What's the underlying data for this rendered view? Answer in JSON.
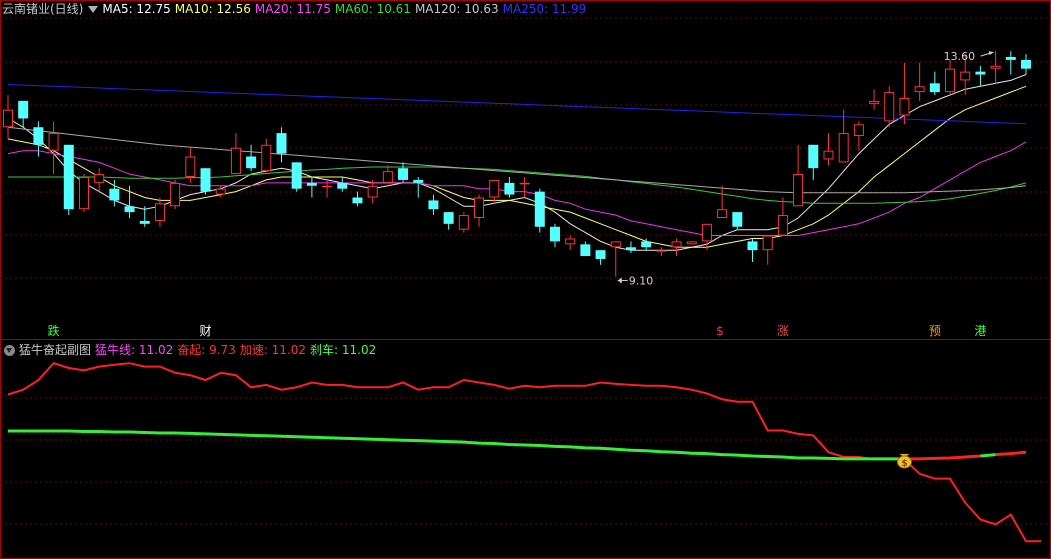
{
  "main_header": {
    "title": "云南锗业(日线)",
    "ma": [
      {
        "label": "MA5: 12.75",
        "color": "#ffffff"
      },
      {
        "label": "MA10: 12.56",
        "color": "#ffff66"
      },
      {
        "label": "MA20: 11.75",
        "color": "#ff44ff"
      },
      {
        "label": "MA60: 10.61",
        "color": "#33dd33"
      },
      {
        "label": "MA120: 10.63",
        "color": "#c8c8c8"
      },
      {
        "label": "MA250: 11.99",
        "color": "#3333ff"
      }
    ]
  },
  "sub_header": {
    "title": "猛牛奋起副图",
    "values": [
      {
        "label": "猛牛线: 11.02",
        "color": "#ff44ff"
      },
      {
        "label": "奋起: 9.73",
        "color": "#ff3333"
      },
      {
        "label": "加速: 11.02",
        "color": "#ff3333"
      },
      {
        "label": "刹车: 11.02",
        "color": "#44ff44"
      }
    ]
  },
  "annotations": {
    "high_label": "13.60",
    "low_label": "9.10"
  },
  "markers": [
    {
      "text": "跌",
      "color": "#44ff44",
      "date_index": 3
    },
    {
      "text": "财",
      "color": "#ffffff",
      "date_index": 13
    },
    {
      "text": "$",
      "color": "#ff3333",
      "date_index": 47
    },
    {
      "text": "涨",
      "color": "#ff4444",
      "date_index": 51
    },
    {
      "text": "预",
      "color": "#ff9900",
      "date_index": 61
    },
    {
      "text": "港",
      "color": "#44ff44",
      "date_index": 64
    }
  ],
  "money_bag": {
    "icon": "money-bag-icon",
    "date_index": 59
  },
  "chart_data": [
    {
      "type": "candlestick",
      "title": "云南锗业(日线)",
      "colors": {
        "up": "#ff3333",
        "down": "#54ffff"
      },
      "ylim": [
        8.7,
        14.2
      ],
      "ohlc": [
        [
          12.3,
          12.85,
          12.1,
          12.6
        ],
        [
          12.75,
          12.75,
          12.3,
          12.45
        ],
        [
          12.3,
          12.4,
          11.8,
          12.0
        ],
        [
          11.9,
          12.4,
          11.5,
          12.2
        ],
        [
          12.0,
          12.0,
          10.8,
          10.9
        ],
        [
          10.9,
          11.5,
          10.85,
          11.45
        ],
        [
          11.35,
          11.6,
          11.2,
          11.5
        ],
        [
          11.25,
          11.4,
          10.95,
          11.05
        ],
        [
          10.95,
          11.3,
          10.75,
          10.85
        ],
        [
          10.7,
          10.95,
          10.6,
          10.65
        ],
        [
          10.7,
          11.1,
          10.6,
          11.0
        ],
        [
          10.95,
          11.4,
          10.9,
          11.35
        ],
        [
          11.45,
          11.95,
          11.35,
          11.8
        ],
        [
          11.6,
          11.6,
          11.15,
          11.2
        ],
        [
          11.15,
          11.3,
          11.1,
          11.25
        ],
        [
          11.5,
          12.2,
          11.5,
          11.95
        ],
        [
          11.8,
          12.0,
          11.55,
          11.6
        ],
        [
          11.55,
          12.1,
          11.55,
          12.0
        ],
        [
          12.2,
          12.3,
          11.7,
          11.85
        ],
        [
          11.7,
          11.7,
          11.2,
          11.25
        ],
        [
          11.35,
          11.45,
          11.1,
          11.3
        ],
        [
          11.3,
          11.4,
          11.1,
          11.3
        ],
        [
          11.35,
          11.45,
          11.2,
          11.25
        ],
        [
          11.1,
          11.2,
          10.95,
          11.0
        ],
        [
          11.1,
          11.4,
          11.0,
          11.3
        ],
        [
          11.35,
          11.65,
          11.35,
          11.55
        ],
        [
          11.6,
          11.7,
          11.35,
          11.4
        ],
        [
          11.4,
          11.45,
          11.1,
          11.35
        ],
        [
          11.05,
          11.15,
          10.8,
          10.9
        ],
        [
          10.85,
          10.85,
          10.55,
          10.65
        ],
        [
          10.55,
          10.85,
          10.5,
          10.8
        ],
        [
          10.75,
          11.15,
          10.6,
          11.1
        ],
        [
          11.1,
          11.4,
          11.0,
          11.4
        ],
        [
          11.35,
          11.45,
          11.1,
          11.15
        ],
        [
          11.35,
          11.45,
          11.1,
          11.35
        ],
        [
          11.2,
          11.25,
          10.5,
          10.6
        ],
        [
          10.6,
          10.65,
          10.25,
          10.35
        ],
        [
          10.3,
          10.45,
          10.2,
          10.4
        ],
        [
          10.3,
          10.35,
          10.1,
          10.1
        ],
        [
          10.2,
          10.2,
          9.95,
          10.05
        ],
        [
          10.25,
          10.35,
          9.75,
          10.35
        ],
        [
          10.25,
          10.35,
          10.15,
          10.2
        ],
        [
          10.35,
          10.4,
          10.2,
          10.25
        ],
        [
          10.2,
          10.25,
          10.1,
          10.2
        ],
        [
          10.25,
          10.4,
          10.1,
          10.35
        ],
        [
          10.3,
          10.35,
          10.3,
          10.35
        ],
        [
          10.35,
          10.65,
          10.2,
          10.65
        ],
        [
          10.75,
          11.3,
          10.75,
          10.9
        ],
        [
          10.85,
          10.85,
          10.55,
          10.6
        ],
        [
          10.35,
          10.4,
          10.0,
          10.2
        ],
        [
          10.2,
          10.3,
          9.95,
          10.45
        ],
        [
          10.45,
          11.1,
          10.45,
          10.8
        ],
        [
          10.95,
          12.0,
          10.95,
          11.5
        ],
        [
          12.0,
          12.0,
          11.4,
          11.6
        ],
        [
          11.75,
          12.2,
          11.65,
          11.9
        ],
        [
          11.7,
          12.6,
          11.7,
          12.2
        ],
        [
          12.15,
          12.4,
          11.9,
          12.35
        ],
        [
          12.7,
          12.95,
          12.6,
          12.75
        ],
        [
          12.4,
          13.0,
          12.3,
          12.9
        ],
        [
          12.5,
          13.4,
          12.35,
          12.8
        ],
        [
          12.9,
          13.4,
          12.75,
          13.0
        ],
        [
          13.05,
          13.25,
          12.85,
          12.9
        ],
        [
          12.9,
          13.45,
          12.85,
          13.3
        ],
        [
          13.1,
          13.55,
          12.85,
          13.25
        ],
        [
          13.25,
          13.35,
          13.0,
          13.2
        ],
        [
          13.3,
          13.6,
          13.05,
          13.35
        ],
        [
          13.5,
          13.6,
          13.2,
          13.45
        ],
        [
          13.45,
          13.55,
          13.2,
          13.3
        ]
      ],
      "ma": {
        "MA5": [
          12.45,
          12.3,
          12.1,
          11.85,
          11.55,
          11.35,
          11.2,
          11.05,
          10.95,
          10.9,
          10.95,
          11.05,
          11.15,
          11.2,
          11.25,
          11.35,
          11.5,
          11.55,
          11.6,
          11.55,
          11.45,
          11.4,
          11.35,
          11.3,
          11.25,
          11.3,
          11.35,
          11.35,
          11.25,
          11.1,
          10.95,
          10.95,
          11.0,
          11.05,
          11.1,
          11.0,
          10.85,
          10.65,
          10.5,
          10.35,
          10.25,
          10.2,
          10.2,
          10.2,
          10.2,
          10.25,
          10.3,
          10.45,
          10.55,
          10.55,
          10.55,
          10.6,
          10.75,
          11.0,
          11.25,
          11.55,
          11.85,
          12.1,
          12.35,
          12.5,
          12.65,
          12.75,
          12.85,
          12.95,
          13.0,
          13.05,
          13.1,
          13.2
        ],
        "MA10": [
          12.1,
          12.05,
          12.0,
          11.9,
          11.75,
          11.6,
          11.45,
          11.3,
          11.2,
          11.1,
          11.05,
          11.05,
          11.05,
          11.1,
          11.15,
          11.2,
          11.3,
          11.4,
          11.45,
          11.45,
          11.45,
          11.45,
          11.45,
          11.4,
          11.35,
          11.35,
          11.35,
          11.35,
          11.3,
          11.2,
          11.1,
          11.05,
          11.05,
          11.05,
          11.0,
          10.95,
          10.9,
          10.85,
          10.75,
          10.65,
          10.55,
          10.45,
          10.35,
          10.3,
          10.25,
          10.25,
          10.25,
          10.3,
          10.35,
          10.4,
          10.4,
          10.45,
          10.55,
          10.65,
          10.8,
          11.0,
          11.2,
          11.45,
          11.65,
          11.85,
          12.05,
          12.25,
          12.45,
          12.6,
          12.7,
          12.8,
          12.9,
          13.0
        ],
        "MA20": [
          11.85,
          11.9,
          11.9,
          11.85,
          11.8,
          11.75,
          11.7,
          11.6,
          11.5,
          11.45,
          11.4,
          11.35,
          11.3,
          11.3,
          11.3,
          11.3,
          11.3,
          11.35,
          11.35,
          11.35,
          11.35,
          11.35,
          11.35,
          11.35,
          11.35,
          11.35,
          11.35,
          11.35,
          11.3,
          11.3,
          11.3,
          11.25,
          11.25,
          11.2,
          11.2,
          11.15,
          11.05,
          11.0,
          10.9,
          10.85,
          10.8,
          10.7,
          10.65,
          10.6,
          10.55,
          10.5,
          10.45,
          10.45,
          10.45,
          10.45,
          10.45,
          10.45,
          10.45,
          10.5,
          10.55,
          10.6,
          10.65,
          10.75,
          10.85,
          11.0,
          11.1,
          11.25,
          11.4,
          11.55,
          11.7,
          11.8,
          11.9,
          12.05
        ],
        "MA60": [
          11.45,
          11.45,
          11.45,
          11.45,
          11.45,
          11.45,
          11.45,
          11.44,
          11.43,
          11.43,
          11.43,
          11.43,
          11.44,
          11.44,
          11.45,
          11.47,
          11.49,
          11.51,
          11.53,
          11.55,
          11.57,
          11.58,
          11.6,
          11.61,
          11.62,
          11.62,
          11.62,
          11.62,
          11.62,
          11.61,
          11.6,
          11.59,
          11.58,
          11.56,
          11.54,
          11.52,
          11.5,
          11.48,
          11.46,
          11.43,
          11.4,
          11.37,
          11.34,
          11.31,
          11.28,
          11.24,
          11.2,
          11.16,
          11.12,
          11.08,
          11.05,
          11.03,
          11.02,
          11.0,
          11.0,
          11.0,
          11.0,
          11.0,
          11.01,
          11.02,
          11.03,
          11.05,
          11.08,
          11.12,
          11.17,
          11.22,
          11.28,
          11.35
        ],
        "MA120": [
          12.3,
          12.27,
          12.24,
          12.21,
          12.18,
          12.15,
          12.12,
          12.09,
          12.06,
          12.03,
          12.0,
          11.98,
          11.96,
          11.94,
          11.92,
          11.9,
          11.88,
          11.86,
          11.84,
          11.82,
          11.8,
          11.78,
          11.76,
          11.74,
          11.72,
          11.7,
          11.68,
          11.66,
          11.64,
          11.62,
          11.6,
          11.58,
          11.56,
          11.54,
          11.52,
          11.5,
          11.48,
          11.46,
          11.44,
          11.42,
          11.4,
          11.38,
          11.36,
          11.34,
          11.32,
          11.3,
          11.28,
          11.26,
          11.24,
          11.22,
          11.2,
          11.19,
          11.18,
          11.18,
          11.18,
          11.18,
          11.18,
          11.18,
          11.18,
          11.18,
          11.19,
          11.2,
          11.21,
          11.22,
          11.23,
          11.25,
          11.27,
          11.3
        ],
        "MA250": [
          13.03,
          13.02,
          13.01,
          13.0,
          12.99,
          12.98,
          12.97,
          12.96,
          12.95,
          12.94,
          12.93,
          12.92,
          12.91,
          12.9,
          12.89,
          12.88,
          12.87,
          12.86,
          12.85,
          12.84,
          12.83,
          12.82,
          12.81,
          12.8,
          12.79,
          12.78,
          12.77,
          12.76,
          12.75,
          12.74,
          12.73,
          12.72,
          12.71,
          12.7,
          12.69,
          12.68,
          12.67,
          12.66,
          12.65,
          12.64,
          12.63,
          12.62,
          12.61,
          12.6,
          12.59,
          12.58,
          12.57,
          12.56,
          12.55,
          12.54,
          12.53,
          12.52,
          12.51,
          12.5,
          12.49,
          12.48,
          12.47,
          12.46,
          12.45,
          12.44,
          12.43,
          12.42,
          12.41,
          12.4,
          12.39,
          12.38,
          12.37,
          12.36
        ]
      }
    },
    {
      "type": "line",
      "title": "猛牛奋起副图",
      "ylim": [
        9.4,
        13.6
      ],
      "series": [
        {
          "name": "奋起",
          "color": "#ff2020",
          "values": [
            12.8,
            12.9,
            13.1,
            13.45,
            13.35,
            13.3,
            13.38,
            13.42,
            13.45,
            13.38,
            13.38,
            13.25,
            13.2,
            13.1,
            13.25,
            13.2,
            12.95,
            13.0,
            12.9,
            12.95,
            13.05,
            13.0,
            13.0,
            12.95,
            12.95,
            12.95,
            13.05,
            12.9,
            12.95,
            12.95,
            13.1,
            13.05,
            13.0,
            12.92,
            12.98,
            12.95,
            12.98,
            12.98,
            12.98,
            13.05,
            13.02,
            13.0,
            12.98,
            12.98,
            12.95,
            12.9,
            12.82,
            12.7,
            12.65,
            12.65,
            12.05,
            12.05,
            11.98,
            11.95,
            11.6,
            11.5,
            11.5,
            11.45,
            11.45,
            11.45,
            11.15,
            11.05,
            11.05,
            10.55,
            10.2,
            10.1,
            10.3,
            9.75,
            9.75
          ]
        },
        {
          "name": "猛牛线",
          "color": "#33ee33",
          "values": [
            12.04,
            12.04,
            12.04,
            12.04,
            12.04,
            12.03,
            12.03,
            12.02,
            12.02,
            12.01,
            12.0,
            12.0,
            11.99,
            11.98,
            11.97,
            11.96,
            11.95,
            11.94,
            11.93,
            11.92,
            11.91,
            11.9,
            11.89,
            11.88,
            11.87,
            11.86,
            11.85,
            11.84,
            11.83,
            11.82,
            11.81,
            11.79,
            11.78,
            11.76,
            11.75,
            11.74,
            11.72,
            11.71,
            11.69,
            11.68,
            11.66,
            11.64,
            11.63,
            11.61,
            11.6,
            11.58,
            11.57,
            11.55,
            11.54,
            11.52,
            11.51,
            11.5,
            11.48,
            11.48,
            11.47,
            11.46,
            11.46,
            11.46,
            11.46,
            11.46,
            11.46,
            11.47,
            11.48,
            11.5,
            11.52,
            11.55,
            11.57,
            11.6
          ]
        }
      ]
    }
  ]
}
